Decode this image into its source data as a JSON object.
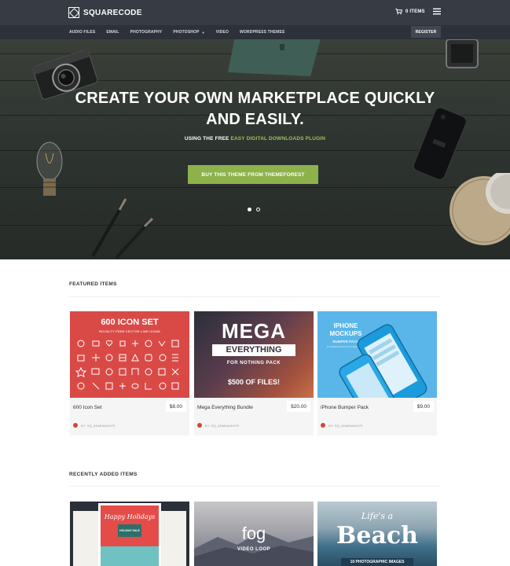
{
  "header": {
    "logo_text": "SQUARECODE",
    "cart_label": "0 ITEMS"
  },
  "nav": {
    "items": [
      "AUDIO FILES",
      "EMAIL",
      "PHOTOGRAPHY",
      "PHOTOSHOP",
      "VIDEO",
      "WORDPRESS THEMES"
    ],
    "register_label": "REGISTER"
  },
  "hero": {
    "headline_line1": "CREATE YOUR OWN MARKETPLACE QUICKLY",
    "headline_line2": "AND EASILY.",
    "sub_prefix": "USING THE FREE ",
    "sub_highlight": "EASY DIGITAL DOWNLOADS PLUGIN",
    "cta_label": "BUY THIS THEME FROM THEMEFOREST",
    "slides": 2,
    "active_slide": 1
  },
  "featured": {
    "title": "FEATURED ITEMS",
    "items": [
      {
        "name": "600 Icon Set",
        "price": "$8.00",
        "author": "BY: SQ_ADMIN481970",
        "art": {
          "headline": "600 ICON SET",
          "subhead": "ROYALTY FREE VECTOR LINE ICONS"
        }
      },
      {
        "name": "Mega Everything Bundle",
        "price": "$20.00",
        "author": "BY: SQ_ADMIN481970",
        "art": {
          "line1": "MEGA",
          "line2": "EVERYTHING",
          "line3": "FOR NOTHING PACK",
          "line4": "$500 OF FILES!"
        }
      },
      {
        "name": "iPhone Bumper Pack",
        "price": "$9.00",
        "author": "BY: SQ_ADMIN481970",
        "art": {
          "line1": "IPHONE",
          "line2": "MOCKUPS",
          "line3": "BUMPER PACK",
          "line4": "10 SEPARATE PHOTOSHOP FILES"
        }
      }
    ]
  },
  "recent": {
    "title": "RECENTLY ADDED ITEMS",
    "items": [
      {
        "art": {
          "line1": "Happy Holidays",
          "line2": "HOLIDAY SALE"
        }
      },
      {
        "art": {
          "line1": "fog",
          "line2": "VIDEO LOOP"
        }
      },
      {
        "art": {
          "line1": "Life's a",
          "line2": "Beach",
          "line3": "10 PHOTOGRAPHIC IMAGES"
        }
      }
    ]
  },
  "colors": {
    "topbar": "#363b44",
    "navbar": "#2d3139",
    "accent_green": "#8db24a",
    "highlight_green": "#9dc15b",
    "icon_set_red": "#d94a47",
    "iphone_blue": "#5ab6e8"
  },
  "icons": [
    "logo-mark-icon",
    "cart-icon",
    "hamburger-menu-icon",
    "chevron-down-icon"
  ]
}
